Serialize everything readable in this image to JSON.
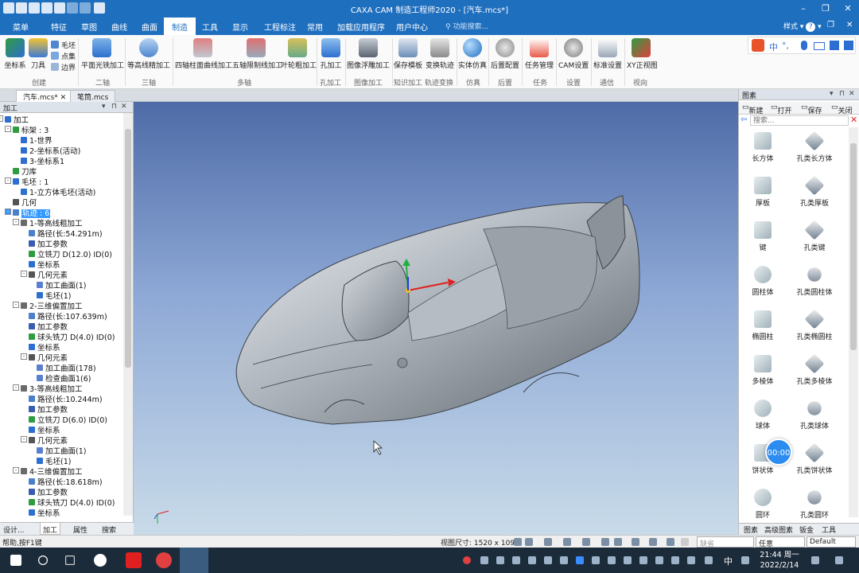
{
  "app": {
    "title": "CAXA CAM 制造工程师2020 - [汽车.mcs*]",
    "window_controls": [
      "–",
      "❐",
      "✕"
    ]
  },
  "menu": {
    "items": [
      "菜单",
      "特征",
      "草图",
      "曲线",
      "曲面",
      "制造",
      "工具",
      "显示",
      "工程标注",
      "常用",
      "加载应用程序",
      "用户中心"
    ],
    "active": "制造",
    "search_placeholder": "功能搜索...",
    "style_label": "样式",
    "help_icon": "?",
    "inner_controls": [
      "–",
      "❐",
      "✕"
    ]
  },
  "ribbon": {
    "buttons": [
      {
        "label": "坐标系",
        "icon": "axis-icon"
      },
      {
        "label": "刀具",
        "icon": "tool-icon"
      },
      {
        "label": "平面光铣加工",
        "icon": "planar-mill-icon"
      },
      {
        "label": "等高线精加工",
        "icon": "contour-finish-icon"
      },
      {
        "label": "四轴柱面曲线加工",
        "icon": "four-axis-cylinder-icon"
      },
      {
        "label": "五轴限制线加工",
        "icon": "five-axis-limit-icon"
      },
      {
        "label": "叶轮粗加工",
        "icon": "impeller-rough-icon"
      },
      {
        "label": "孔加工",
        "icon": "hole-machining-icon"
      },
      {
        "label": "图像浮雕加工",
        "icon": "image-relief-icon"
      },
      {
        "label": "保存模板",
        "icon": "save-template-icon"
      },
      {
        "label": "变换轨迹",
        "icon": "transform-path-icon"
      },
      {
        "label": "实体仿真",
        "icon": "solid-sim-icon"
      },
      {
        "label": "后置配置",
        "icon": "post-config-icon"
      },
      {
        "label": "任务管理",
        "icon": "task-manage-icon"
      },
      {
        "label": "CAM设置",
        "icon": "cam-settings-icon"
      },
      {
        "label": "标准设置",
        "icon": "standard-settings-icon"
      },
      {
        "label": "XY正视图",
        "icon": "xy-view-icon"
      }
    ],
    "small_items": [
      "毛坯",
      "点集",
      "边界"
    ],
    "groups": [
      "创建",
      "二轴",
      "三轴",
      "多轴",
      "孔加工",
      "图像加工",
      "知识加工",
      "轨迹变换",
      "仿真",
      "后置",
      "任务",
      "设置",
      "通信",
      "视向"
    ],
    "ime_chars": [
      "中",
      "°,"
    ],
    "colors": {
      "titlebar": "#1f6fbf",
      "ribbon": "#fafafa",
      "accent": "#3399ff"
    }
  },
  "doc_tabs": [
    "汽车.mcs*",
    "笔筒.mcs"
  ],
  "left_panel": {
    "title": "加工",
    "controls": [
      "▾",
      "⊓",
      "✕"
    ],
    "tree": [
      {
        "label": "加工",
        "icon": "gear-icon"
      },
      {
        "label": "标架 : 3",
        "icon": "frame-icon"
      },
      {
        "label": "1-世界",
        "icon": "axis-icon"
      },
      {
        "label": "2-坐标系(活动)",
        "icon": "axis-icon"
      },
      {
        "label": "3-坐标系1",
        "icon": "axis-icon"
      },
      {
        "label": "刀库",
        "icon": "tool-icon"
      },
      {
        "label": "毛坯 : 1",
        "icon": "stock-icon"
      },
      {
        "label": "1-立方体毛坯(活动)",
        "icon": "stock-icon"
      },
      {
        "label": "几何",
        "icon": "geometry-icon"
      },
      {
        "label": "轨迹 : 6",
        "icon": "path-icon"
      },
      {
        "label": "1-等高线粗加工",
        "icon": "operation-icon"
      },
      {
        "label": "路径(长:54.291m)",
        "icon": "path-icon"
      },
      {
        "label": "加工参数",
        "icon": "params-icon"
      },
      {
        "label": "立铣刀 D(12.0) ID(0)",
        "icon": "tool-icon"
      },
      {
        "label": "坐标系",
        "icon": "axis-icon"
      },
      {
        "label": "几何元素",
        "icon": "geometry-icon"
      },
      {
        "label": "加工曲面(1)",
        "icon": "surface-icon"
      },
      {
        "label": "毛坯(1)",
        "icon": "stock-icon"
      },
      {
        "label": "2-三维偏置加工",
        "icon": "operation-icon"
      },
      {
        "label": "路径(长:107.639m)",
        "icon": "path-icon"
      },
      {
        "label": "加工参数",
        "icon": "params-icon"
      },
      {
        "label": "球头铣刀 D(4.0) ID(0)",
        "icon": "tool-icon"
      },
      {
        "label": "坐标系",
        "icon": "axis-icon"
      },
      {
        "label": "几何元素",
        "icon": "geometry-icon"
      },
      {
        "label": "加工曲面(178)",
        "icon": "surface-icon"
      },
      {
        "label": "检查曲面1(6)",
        "icon": "surface-icon"
      },
      {
        "label": "3-等高线粗加工",
        "icon": "operation-icon"
      },
      {
        "label": "路径(长:10.244m)",
        "icon": "path-icon"
      },
      {
        "label": "加工参数",
        "icon": "params-icon"
      },
      {
        "label": "立铣刀 D(6.0) ID(0)",
        "icon": "tool-icon"
      },
      {
        "label": "坐标系",
        "icon": "axis-icon"
      },
      {
        "label": "几何元素",
        "icon": "geometry-icon"
      },
      {
        "label": "加工曲面(1)",
        "icon": "surface-icon"
      },
      {
        "label": "毛坯(1)",
        "icon": "stock-icon"
      },
      {
        "label": "4-三维偏置加工",
        "icon": "operation-icon"
      },
      {
        "label": "路径(长:18.618m)",
        "icon": "path-icon"
      },
      {
        "label": "加工参数",
        "icon": "params-icon"
      },
      {
        "label": "球头铣刀 D(4.0) ID(0)",
        "icon": "tool-icon"
      },
      {
        "label": "坐标系",
        "icon": "axis-icon"
      }
    ],
    "bottom_tabs": [
      "设计...",
      "加工",
      "属性",
      "搜索"
    ],
    "active_bottom_tab": "加工"
  },
  "right_panel": {
    "title": "图素",
    "controls": [
      "▾",
      "⊓",
      "✕"
    ],
    "toolbar": [
      "新建",
      "打开",
      "保存",
      "关闭"
    ],
    "search_placeholder": "搜索...",
    "shapes": [
      "长方体",
      "孔类长方体",
      "厚板",
      "孔类厚板",
      "键",
      "孔类键",
      "圆柱体",
      "孔类圆柱体",
      "椭圆柱",
      "孔类椭圆柱",
      "多棱体",
      "孔类多棱体",
      "球体",
      "孔类球体",
      "饼状体",
      "孔类饼状体",
      "圆环",
      "孔类圆环"
    ],
    "bottom_tabs": [
      "图素",
      "高级图素",
      "钣金",
      "工具"
    ]
  },
  "timer_overlay": "00:00",
  "statusbar": {
    "help": "帮助,按F1键",
    "view_size": "视图尺寸: 1520 x 1091",
    "field_placeholder": "缺省",
    "snap_mode": "任意",
    "default_label": "Default"
  },
  "taskbar": {
    "time": "21:44 周一",
    "date": "2022/2/14",
    "ime": "中"
  }
}
